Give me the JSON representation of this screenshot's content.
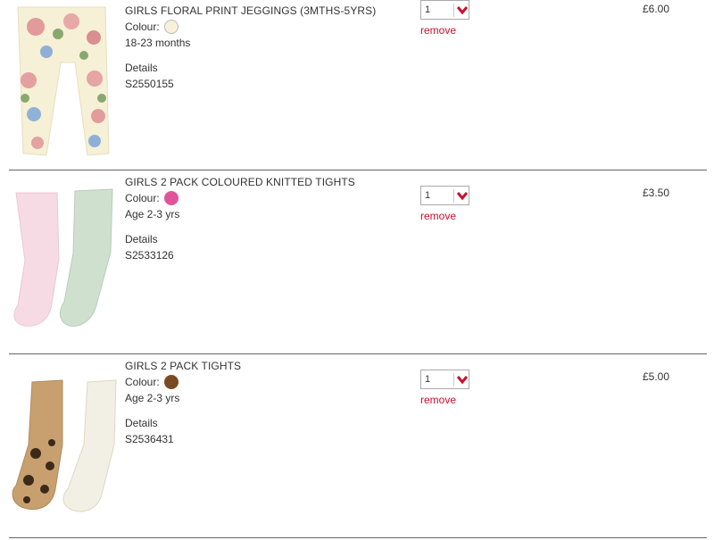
{
  "items": [
    {
      "title": "GIRLS FLORAL PRINT JEGGINGS (3MTHS-5YRS)",
      "colour_label": "Colour:",
      "colour_hex": "#f6f1d8",
      "size": "18-23 months",
      "details_label": "Details",
      "sku": "S2550155",
      "quantity": "1",
      "remove_label": "remove",
      "price": "£6.00",
      "image": "floral-jeggings"
    },
    {
      "title": "GIRLS 2 PACK COLOURED KNITTED TIGHTS",
      "colour_label": "Colour:",
      "colour_hex": "#e0559a",
      "size": "Age 2-3 yrs",
      "details_label": "Details",
      "sku": "S2533126",
      "quantity": "1",
      "remove_label": "remove",
      "price": "£3.50",
      "image": "pink-and-mint-tights"
    },
    {
      "title": "GIRLS 2 PACK TIGHTS",
      "colour_label": "Colour:",
      "colour_hex": "#7a4a22",
      "size": "Age 2-3 yrs",
      "details_label": "Details",
      "sku": "S2536431",
      "quantity": "1",
      "remove_label": "remove",
      "price": "£5.00",
      "image": "leopard-and-cream-tights"
    }
  ],
  "colors": {
    "remove": "#c8102e",
    "chevron": "#c8102e",
    "divider": "#666666"
  }
}
